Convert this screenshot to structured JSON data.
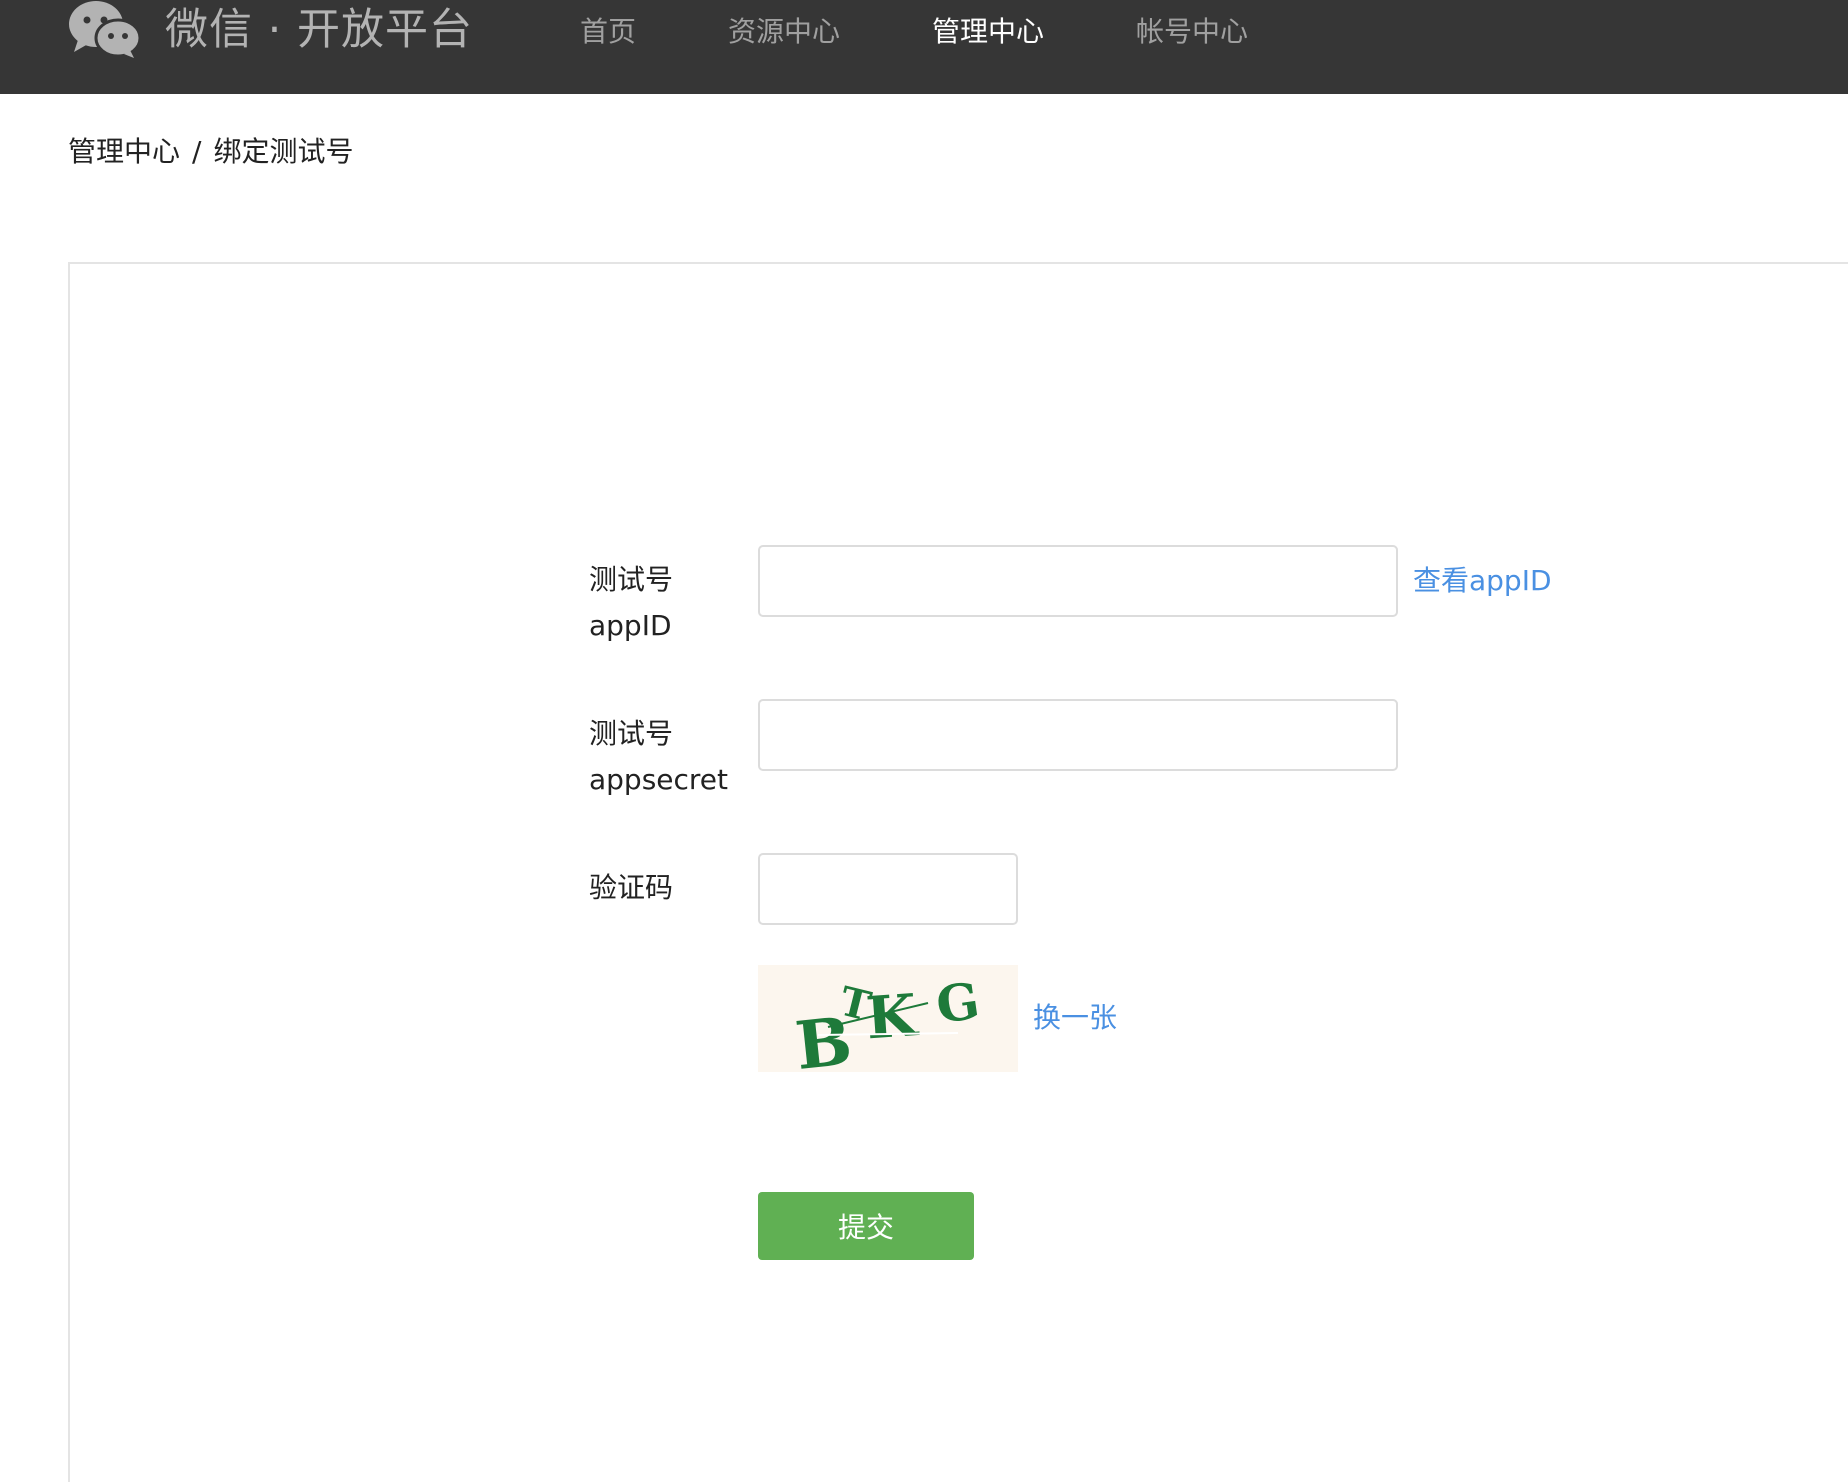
{
  "header": {
    "brand": "微信 · 开放平台",
    "nav": [
      {
        "label": "首页",
        "active": false
      },
      {
        "label": "资源中心",
        "active": false
      },
      {
        "label": "管理中心",
        "active": true
      },
      {
        "label": "帐号中心",
        "active": false
      }
    ],
    "colors": {
      "background": "#363636",
      "nav_text": "#a0a0a0",
      "nav_active": "#ffffff"
    }
  },
  "breadcrumb": {
    "parent": "管理中心",
    "separator": "/",
    "current": "绑定测试号"
  },
  "form": {
    "appid": {
      "label_line1": "测试号",
      "label_line2": "appID",
      "value": "",
      "link": "查看appID"
    },
    "appsecret": {
      "label_line1": "测试号",
      "label_line2": "appsecret",
      "value": ""
    },
    "captcha": {
      "label": "验证码",
      "value": "",
      "image_text": "BTKG",
      "refresh_link": "换一张"
    },
    "submit_label": "提交"
  },
  "colors": {
    "link": "#4a90e2",
    "submit": "#60b053",
    "captcha_bg": "#fcf6ee",
    "captcha_text": "#1e7a3a"
  }
}
